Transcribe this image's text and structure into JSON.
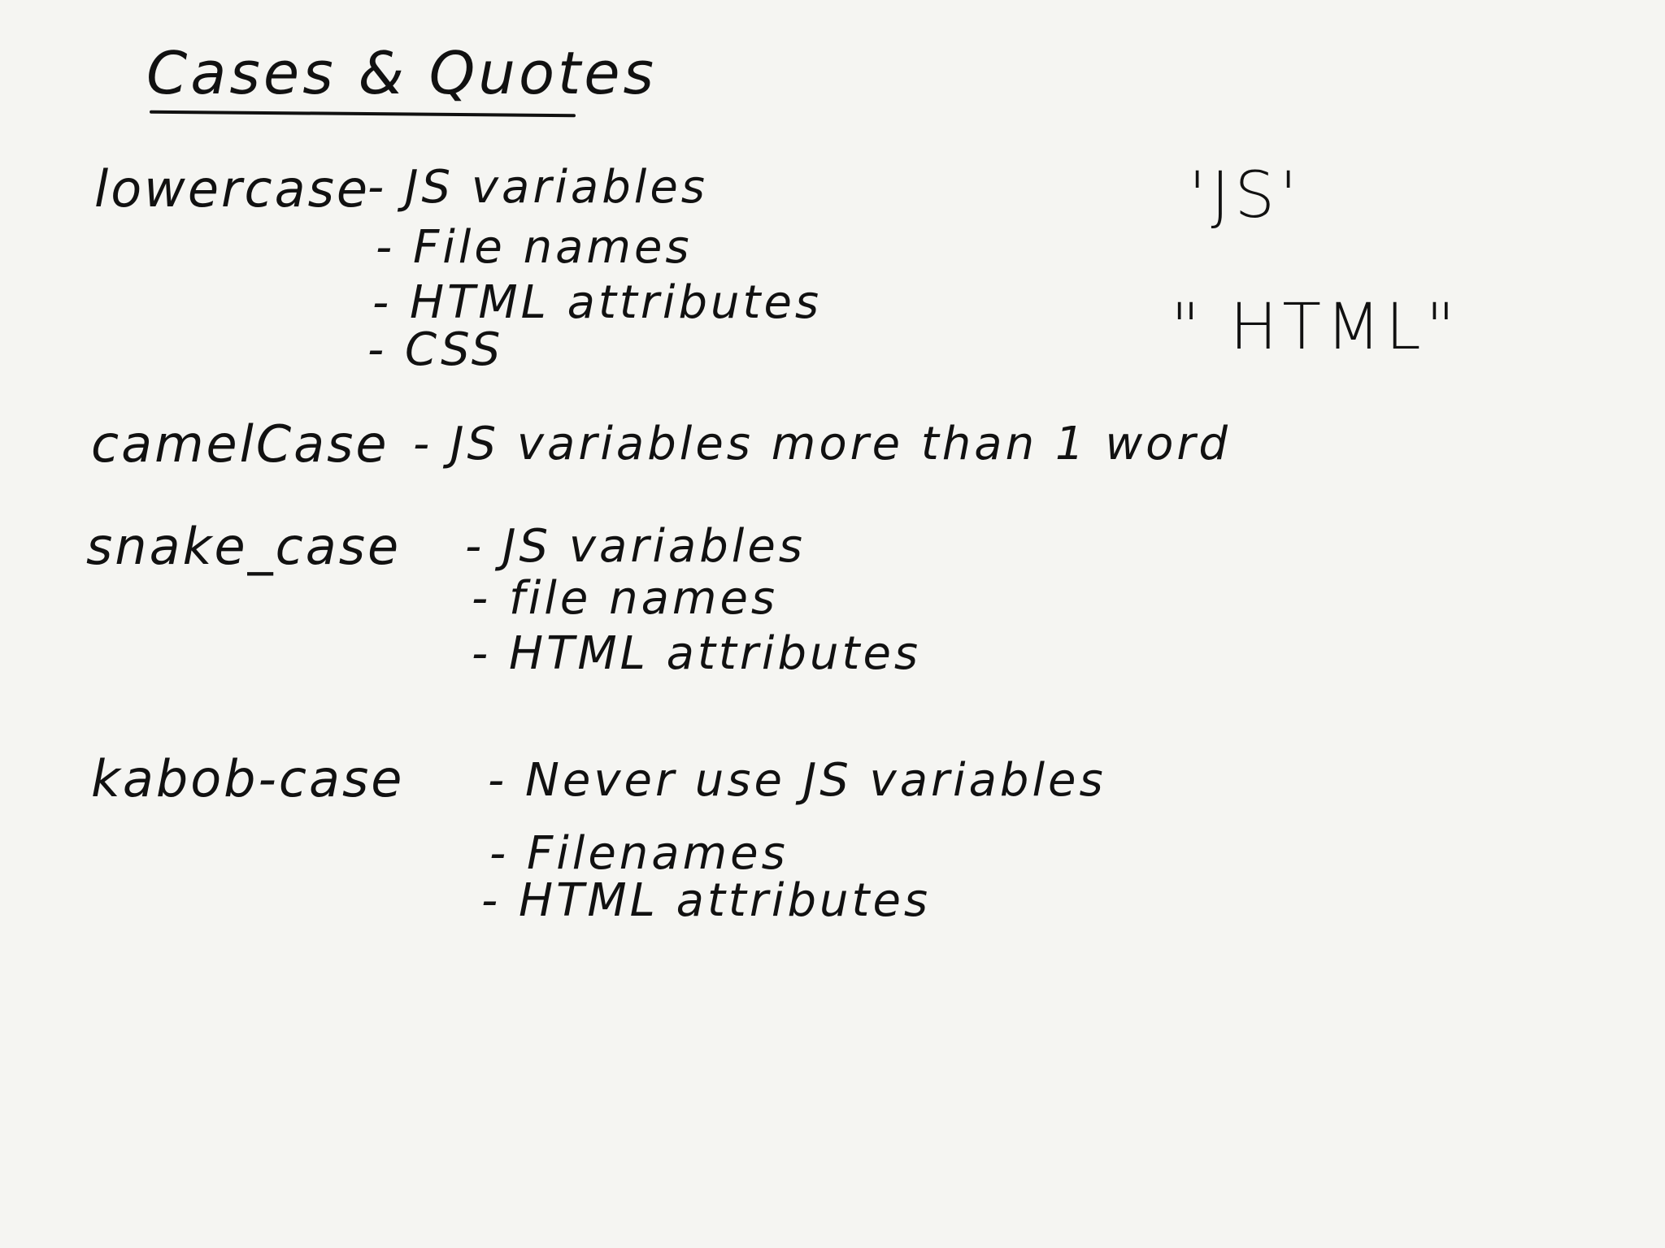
{
  "title": "Cases & Quotes",
  "sections": [
    {
      "name": "lowercase",
      "uses": [
        "- JS variables",
        "- File names",
        "- HTML attributes",
        "- CSS"
      ]
    },
    {
      "name": "camelCase",
      "uses": [
        "- JS variables more than 1 word"
      ]
    },
    {
      "name": "snake_case",
      "uses": [
        "- JS variables",
        "- file names",
        "- HTML attributes"
      ]
    },
    {
      "name": "kabob-case",
      "uses": [
        "- Never use JS variables",
        "- Filenames",
        "- HTML attributes"
      ]
    }
  ],
  "quotes": {
    "single": "'JS'",
    "double": "\" HTML\""
  }
}
